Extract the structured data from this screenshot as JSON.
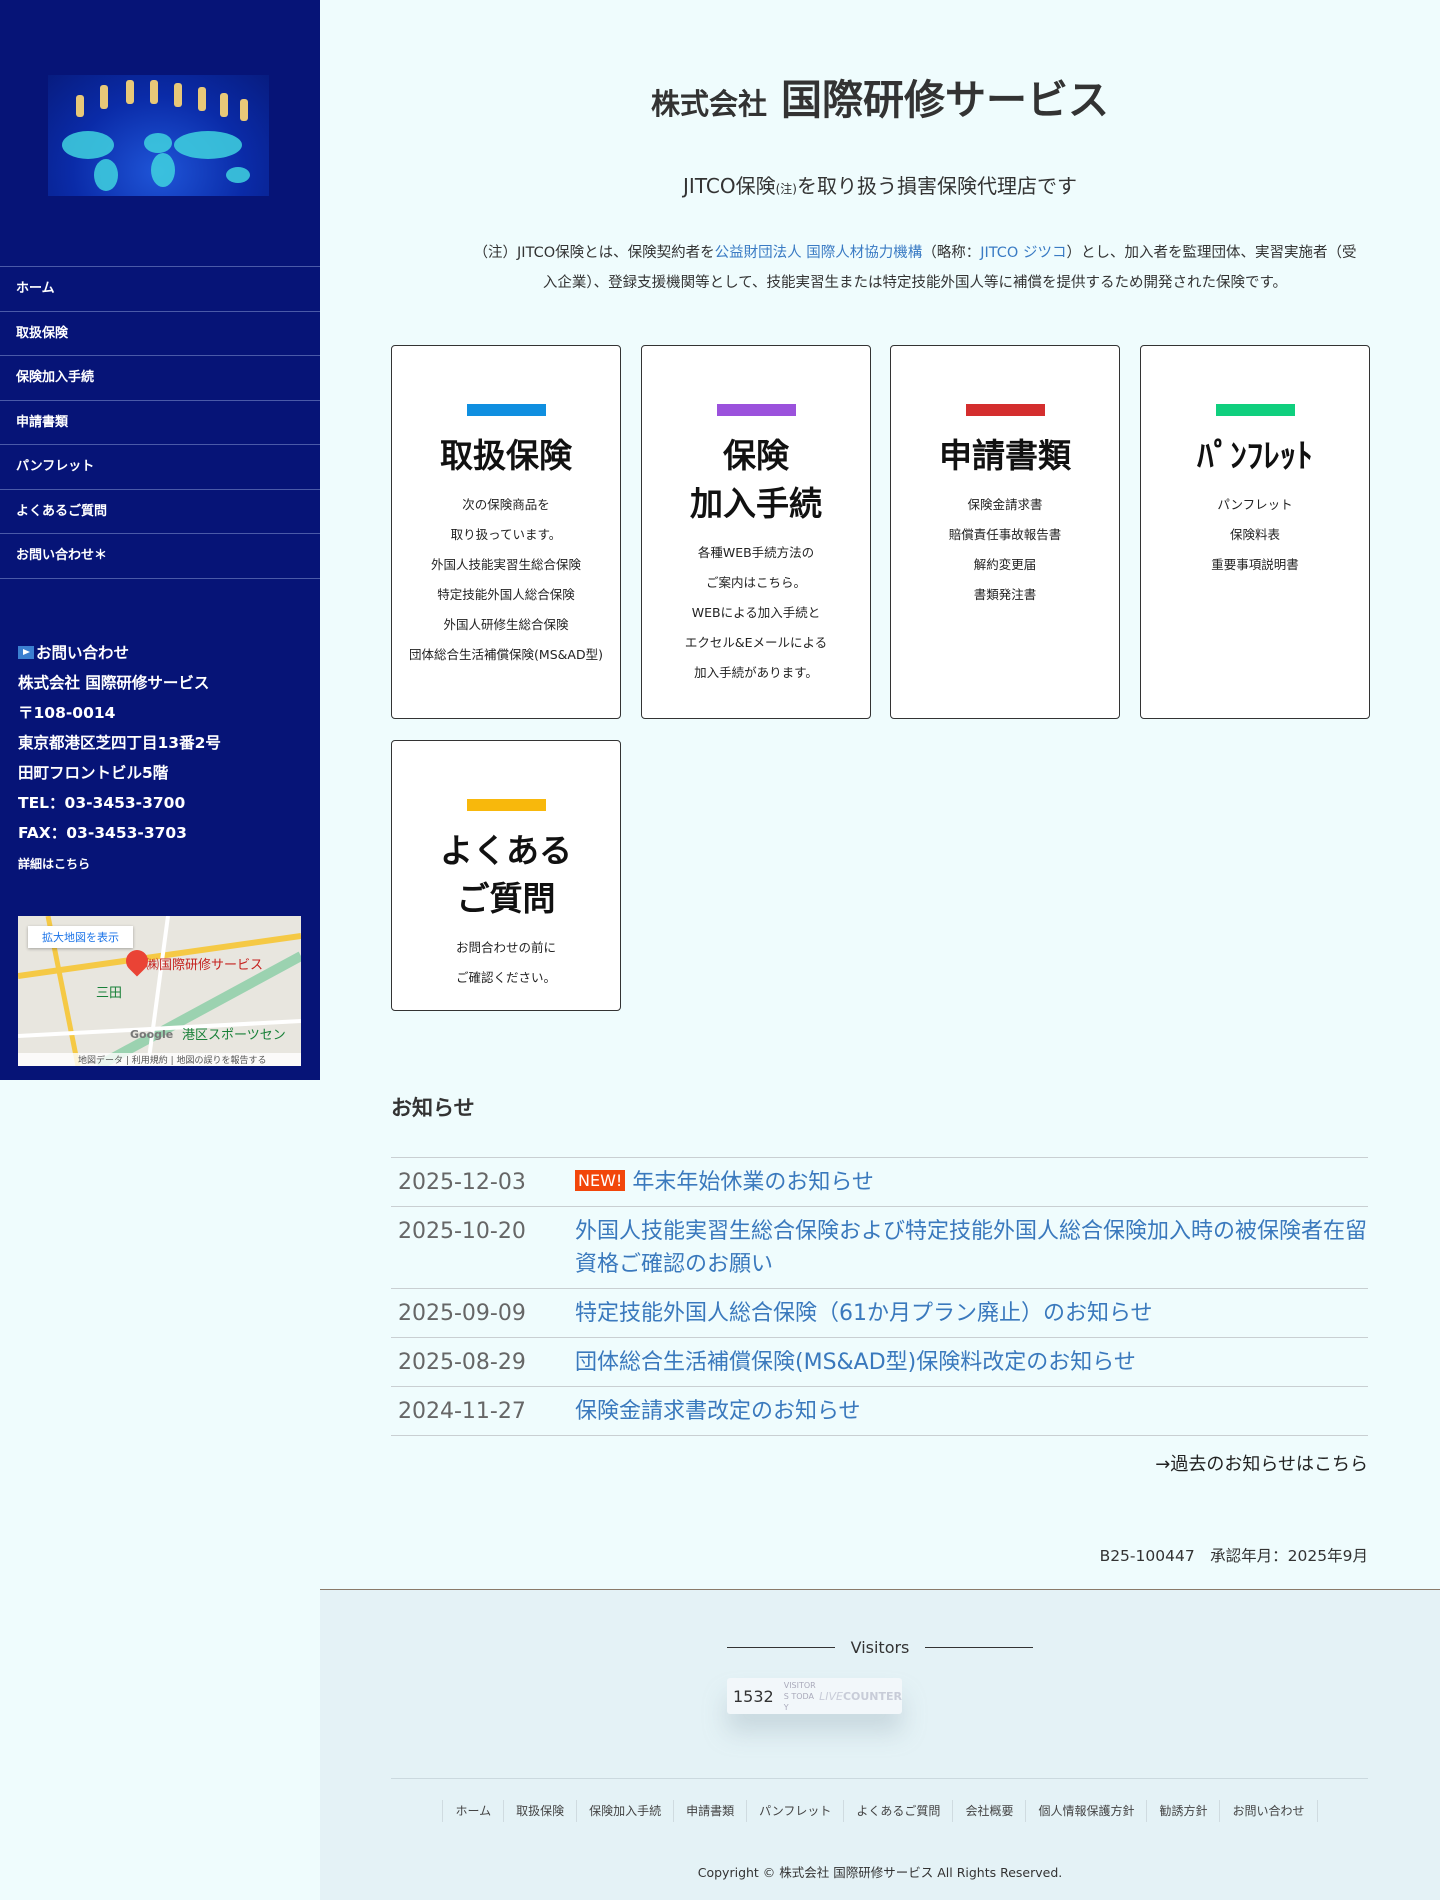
{
  "sidebar": {
    "nav": [
      "ホーム",
      "取扱保険",
      "保険加入手続",
      "申請書類",
      "パンフレット",
      "よくあるご質問",
      "お問い合わせ＊"
    ],
    "contact": {
      "heading": "お問い合わせ",
      "company": "株式会社 国際研修サービス",
      "postal": "〒108-0014",
      "address1": "東京都港区芝四丁目13番2号",
      "address2": "田町フロントビル5階",
      "tel": "TEL：03-3453-3700",
      "fax": "FAX：03-3453-3703",
      "details_link": "詳細はこちら"
    },
    "map": {
      "enlarge": "拡大地図を表示",
      "place": "㈱国際研修サービス",
      "station": "三田",
      "sports": "港区スポーツセン",
      "footer": "地図データ | 利用規約 | 地図の誤りを報告する",
      "google": "Google"
    }
  },
  "header": {
    "company_prefix": "株式会社",
    "company_name": "国際研修サービス",
    "subtitle_pre": "JITCO保険",
    "subtitle_note": "(注)",
    "subtitle_post": "を取り扱う損害保険代理店です"
  },
  "note": {
    "p1": "（注）JITCO保険とは、保険契約者を",
    "link1": "公益財団法人 国際人材協力機構",
    "p2": "（略称：",
    "link2": "JITCO ジツコ",
    "p3": "）とし、加入者を監理団体、実習実施者（受入企業）、登録支援機関等として、技能実習生または特定技能外国人等に補償を提供するため開発された保険です。"
  },
  "cards": [
    {
      "title": "取扱保険",
      "color": "#0f8fe0",
      "lines": [
        "次の保険商品を",
        "取り扱っています。",
        "外国人技能実習生総合保険",
        "特定技能外国人総合保険",
        "外国人研修生総合保険",
        "団体総合生活補償保険(MS&AD型)"
      ]
    },
    {
      "title": "保険\n加入手続",
      "color": "#9b52dc",
      "lines": [
        "各種WEB手続方法の",
        "ご案内はこちら。",
        "WEBによる加入手続と",
        "エクセル&Eメールによる",
        "加入手続があります。"
      ]
    },
    {
      "title": "申請書類",
      "color": "#d42e2e",
      "lines": [
        "保険金請求書",
        "賠償責任事故報告書",
        "解約変更届",
        "書類発注書"
      ]
    },
    {
      "title": "ﾊﾟﾝﾌﾚｯﾄ",
      "color": "#0fcf7e",
      "lines": [
        "パンフレット",
        "保険料表",
        "重要事項説明書"
      ]
    },
    {
      "title": "よくある\nご質問",
      "color": "#f8b80c",
      "lines": [
        "お問合わせの前に",
        "ご確認ください。"
      ]
    }
  ],
  "news": {
    "title": "お知らせ",
    "new_badge": "NEW!",
    "items": [
      {
        "date": "2025-12-03",
        "title": "年末年始休業のお知らせ",
        "new": true
      },
      {
        "date": "2025-10-20",
        "title": "外国人技能実習生総合保険および特定技能外国人総合保険加入時の被保険者在留資格ご確認のお願い"
      },
      {
        "date": "2025-09-09",
        "title": "特定技能外国人総合保険（61か月プラン廃止）のお知らせ"
      },
      {
        "date": "2025-08-29",
        "title": "団体総合生活補償保険(MS&AD型)保険料改定のお知らせ"
      },
      {
        "date": "2024-11-27",
        "title": "保険金請求書改定のお知らせ"
      }
    ],
    "more": "→過去のお知らせはこちら"
  },
  "approval": "B25-100447　承認年月：2025年9月",
  "footer": {
    "visitors_label": "Visitors",
    "counter": "1532",
    "counter_label": "VISITORS TODAY",
    "counter_brand_live": "LIVE",
    "counter_brand": "COUNTER",
    "nav": [
      "ホーム",
      "取扱保険",
      "保険加入手続",
      "申請書類",
      "パンフレット",
      "よくあるご質問",
      "会社概要",
      "個人情報保護方針",
      "勧誘方針",
      "お問い合わせ"
    ],
    "copyright": "Copyright © 株式会社 国際研修サービス All Rights Reserved."
  }
}
